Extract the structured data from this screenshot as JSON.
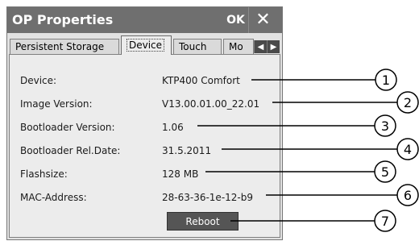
{
  "dialog": {
    "title": "OP Properties",
    "ok_label": "OK",
    "close_icon": "close-icon"
  },
  "tabs": [
    {
      "label": "Persistent Storage",
      "active": false
    },
    {
      "label": "Device",
      "active": true
    },
    {
      "label": "Touch",
      "active": false
    },
    {
      "label": "Mo",
      "active": false
    }
  ],
  "tab_scroll": {
    "left_icon": "arrow-left-icon",
    "right_icon": "arrow-right-icon"
  },
  "device": {
    "rows": [
      {
        "label": "Device:",
        "value": "KTP400 Comfort"
      },
      {
        "label": "Image Version:",
        "value": "V13.00.01.00_22.01"
      },
      {
        "label": "Bootloader Version:",
        "value": "1.06"
      },
      {
        "label": "Bootloader Rel.Date:",
        "value": "31.5.2011"
      },
      {
        "label": "Flashsize:",
        "value": "128 MB"
      },
      {
        "label": "MAC-Address:",
        "value": "28-63-36-1e-12-b9"
      }
    ],
    "reboot_label": "Reboot"
  },
  "callouts": [
    "1",
    "2",
    "3",
    "4",
    "5",
    "6",
    "7"
  ]
}
